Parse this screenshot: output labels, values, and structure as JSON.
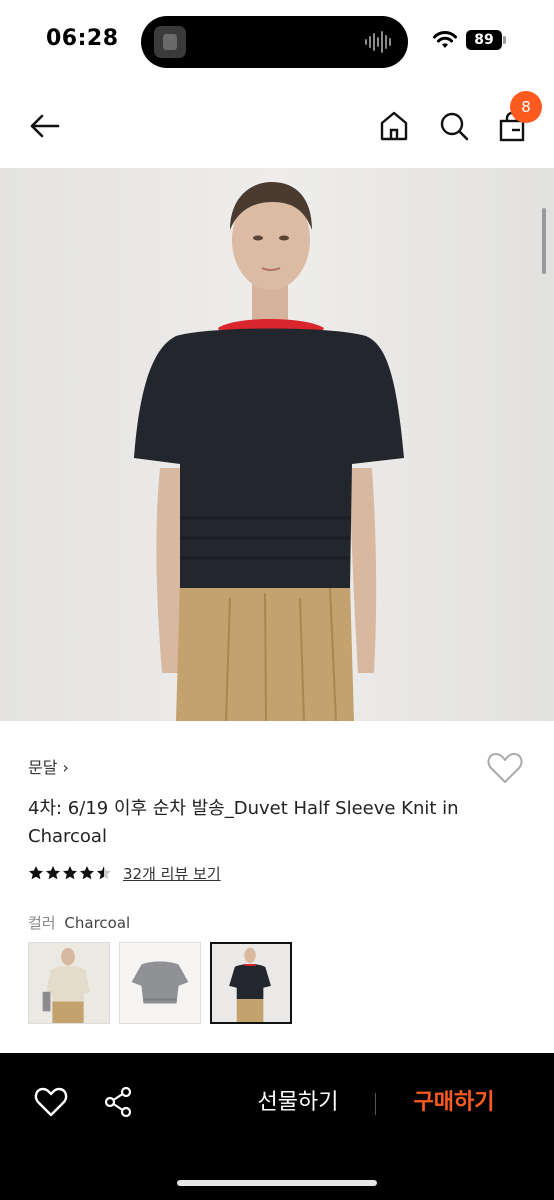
{
  "status": {
    "time": "06:28",
    "battery": "89"
  },
  "nav": {
    "cart_count": "8"
  },
  "product": {
    "brand": "문달",
    "title": "4차: 6/19 이후 순차 발송_Duvet Half Sleeve Knit in Charcoal",
    "rating": 4.5,
    "review_link": "32개 리뷰 보기",
    "color_label": "컬러",
    "color_value": "Charcoal",
    "swatches": [
      {
        "name": "Ivory",
        "selected": false
      },
      {
        "name": "Grey",
        "selected": false
      },
      {
        "name": "Charcoal",
        "selected": true
      }
    ]
  },
  "actions": {
    "gift_label": "선물하기",
    "buy_label": "구매하기"
  },
  "colors": {
    "accent": "#ff5a1f",
    "bottom_bar": "#000000",
    "photo_bg": "#e9e8e6",
    "knit": "#23272d",
    "pants": "#c3a26e",
    "collar": "#d8262c"
  }
}
